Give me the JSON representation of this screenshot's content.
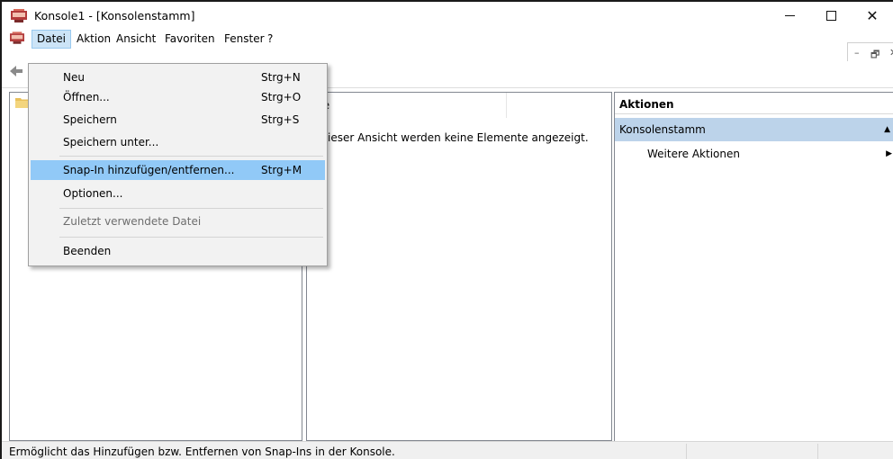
{
  "window": {
    "title": "Konsole1 - [Konsolenstamm]",
    "controls": {
      "minimize": "—",
      "maximize": "☐",
      "close": "✕"
    }
  },
  "menubar": {
    "items": [
      {
        "label": "Datei",
        "active": true
      },
      {
        "label": "Aktion"
      },
      {
        "label": "Ansicht"
      },
      {
        "label": "Favoriten"
      },
      {
        "label": "Fenster"
      },
      {
        "label": "?"
      }
    ],
    "mdi_controls": {
      "minimize": "–",
      "restore": "🗗",
      "close": "✕"
    }
  },
  "file_menu": {
    "items": [
      {
        "label": "Neu",
        "shortcut": "Strg+N"
      },
      {
        "label": "Öffnen...",
        "shortcut": "Strg+O"
      },
      {
        "label": "Speichern",
        "shortcut": "Strg+S"
      },
      {
        "label": "Speichern unter...",
        "shortcut": ""
      },
      {
        "label": "Snap-In hinzufügen/entfernen...",
        "shortcut": "Strg+M",
        "highlighted": true
      },
      {
        "label": "Optionen...",
        "shortcut": ""
      },
      {
        "label": "Zuletzt verwendete Datei",
        "shortcut": "",
        "disabled": true
      },
      {
        "label": "Beenden",
        "shortcut": ""
      }
    ]
  },
  "middle_pane": {
    "column_header": "me",
    "empty_message": "n dieser Ansicht werden keine Elemente angezeigt."
  },
  "actions_pane": {
    "header": "Aktionen",
    "section": "Konsolenstamm",
    "items": [
      {
        "label": "Weitere Aktionen"
      }
    ]
  },
  "statusbar": {
    "text": "Ermöglicht das Hinzufügen bzw. Entfernen von Snap-Ins in der Konsole."
  },
  "colors": {
    "menu_highlight": "#91c9f7",
    "actions_section": "#bcd3ea",
    "menu_background": "#f2f2f2",
    "active_menu": "#cce4f7"
  },
  "icons": [
    "mmc-console-icon",
    "back-arrow-icon",
    "folder-icon",
    "collapse-caret-icon",
    "submenu-arrow-icon"
  ]
}
